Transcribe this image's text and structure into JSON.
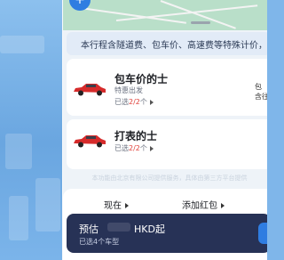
{
  "notice": {
    "text": "本行程含隧道费、包车价、高速费等特殊计价，点"
  },
  "cards": [
    {
      "title": "包车价的士",
      "subtitle": "特惠出发",
      "selected_prefix": "已选",
      "selected_count": "2/2",
      "selected_suffix": "个",
      "right_line1": "包",
      "right_line2": "含往"
    },
    {
      "title": "打表的士",
      "selected_prefix": "已选",
      "selected_count": "2/2",
      "selected_suffix": "个"
    }
  ],
  "footnote": "本功能由北京有限公司提供服务，具体由第三方平台提供",
  "options": {
    "now": "现在",
    "add_coupon": "添加红包"
  },
  "estimate": {
    "label": "预估",
    "price": "HKD起",
    "car_types": "已选4个车型"
  },
  "colors": {
    "accent": "#2f7de1",
    "cta_bg": "#273256",
    "highlight": "#e0413a"
  }
}
